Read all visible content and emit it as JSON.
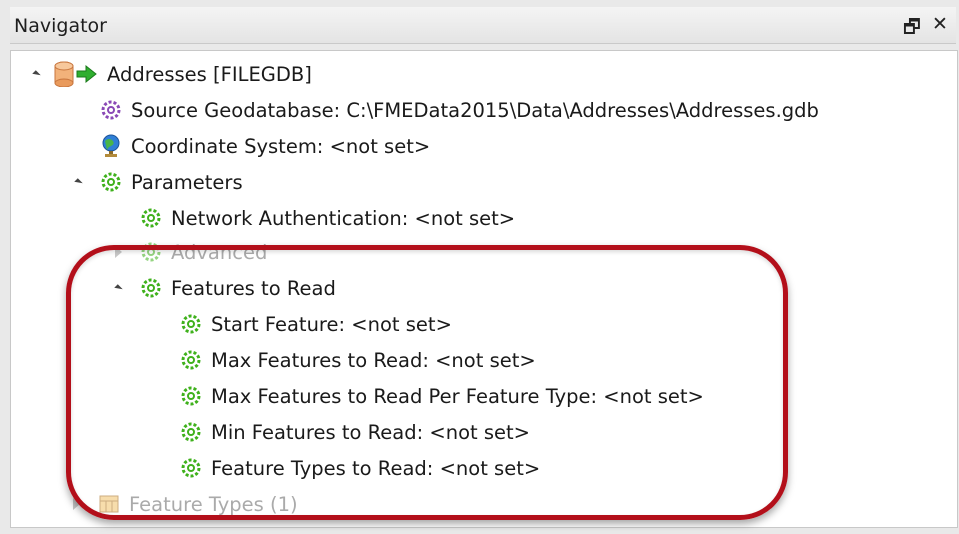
{
  "panel": {
    "title": "Navigator",
    "float_glyph": "🗗",
    "close_glyph": "✕"
  },
  "tree": {
    "reader": {
      "label": "Addresses [FILEGDB]",
      "icon": "database-reader-icon"
    },
    "source": {
      "label": "Source Geodatabase: C:\\FMEData2015\\Data\\Addresses\\Addresses.gdb",
      "icon": "purple-gear-icon"
    },
    "coord": {
      "label": "Coordinate System: <not set>",
      "icon": "globe-icon"
    },
    "parameters": {
      "label": "Parameters",
      "icon": "green-gear-icon"
    },
    "network_auth": {
      "label": "Network Authentication: <not set>"
    },
    "advanced": {
      "label": "Advanced"
    },
    "features_to_read": {
      "label": "Features to Read"
    },
    "start_feature": {
      "label": "Start Feature: <not set>"
    },
    "max_features": {
      "label": "Max Features to Read: <not set>"
    },
    "max_per_type": {
      "label": "Max Features to Read Per Feature Type: <not set>"
    },
    "min_features": {
      "label": "Min Features to Read: <not set>"
    },
    "feature_types_to_read": {
      "label": "Feature Types to Read: <not set>"
    },
    "feature_types": {
      "label": "Feature Types (1)",
      "icon": "table-icon"
    }
  },
  "colors": {
    "highlight": "#b30f1a",
    "gear_green": "#3fb11c",
    "gear_purple": "#8a49b6"
  }
}
